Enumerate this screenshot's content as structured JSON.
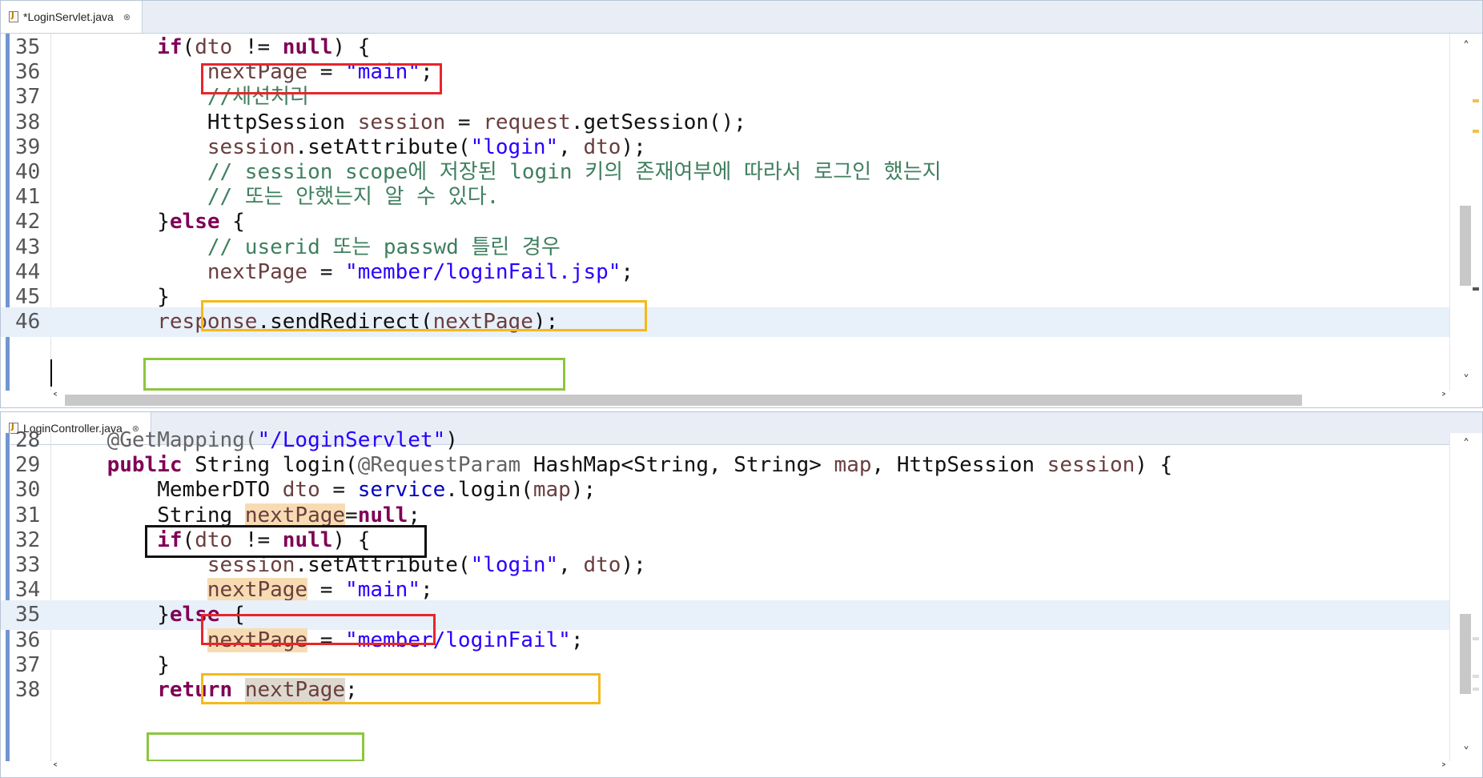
{
  "top_editor": {
    "tab_title": "*LoginServlet.java",
    "tab_close": "⊗",
    "lines": [
      {
        "num": "35",
        "tokens": [
          [
            "        ",
            ""
          ],
          [
            "if",
            "kw"
          ],
          [
            "(",
            ""
          ],
          [
            "dto",
            "var"
          ],
          [
            " != ",
            ""
          ],
          [
            "null",
            "kw"
          ],
          [
            ") {",
            ""
          ]
        ]
      },
      {
        "num": "36",
        "tokens": [
          [
            "            ",
            ""
          ],
          [
            "nextPage",
            "var"
          ],
          [
            " = ",
            ""
          ],
          [
            "\"main\"",
            "str"
          ],
          [
            ";",
            ""
          ]
        ]
      },
      {
        "num": "37",
        "tokens": [
          [
            "            ",
            ""
          ],
          [
            "//세션처리",
            "cm"
          ]
        ]
      },
      {
        "num": "38",
        "tokens": [
          [
            "            ",
            ""
          ],
          [
            "HttpSession ",
            ""
          ],
          [
            "session",
            "var"
          ],
          [
            " = ",
            ""
          ],
          [
            "request",
            "var"
          ],
          [
            ".getSession();",
            ""
          ]
        ]
      },
      {
        "num": "39",
        "tokens": [
          [
            "            ",
            ""
          ],
          [
            "session",
            "var"
          ],
          [
            ".setAttribute(",
            ""
          ],
          [
            "\"login\"",
            "str"
          ],
          [
            ", ",
            ""
          ],
          [
            "dto",
            "var"
          ],
          [
            ");",
            ""
          ]
        ]
      },
      {
        "num": "40",
        "tokens": [
          [
            "            ",
            ""
          ],
          [
            "// session scope에 저장된 login 키의 존재여부에 따라서 로그인 했는지",
            "cm"
          ]
        ]
      },
      {
        "num": "41",
        "tokens": [
          [
            "            ",
            ""
          ],
          [
            "// 또는 안했는지 알 수 있다.",
            "cm"
          ]
        ]
      },
      {
        "num": "42",
        "tokens": [
          [
            "        ",
            ""
          ],
          [
            "}",
            ""
          ],
          [
            "else",
            "kw"
          ],
          [
            " {",
            ""
          ]
        ]
      },
      {
        "num": "43",
        "tokens": [
          [
            "            ",
            ""
          ],
          [
            "// userid 또는 passwd 틀린 경우",
            "cm"
          ]
        ]
      },
      {
        "num": "44",
        "tokens": [
          [
            "            ",
            ""
          ],
          [
            "nextPage",
            "var"
          ],
          [
            " = ",
            ""
          ],
          [
            "\"member/loginFail.jsp\"",
            "str"
          ],
          [
            ";",
            ""
          ]
        ]
      },
      {
        "num": "45",
        "tokens": [
          [
            "        ",
            ""
          ],
          [
            "}",
            ""
          ]
        ]
      },
      {
        "num": "46",
        "tokens": [
          [
            "        ",
            ""
          ],
          [
            "response",
            "var"
          ],
          [
            ".sendRedirect(",
            ""
          ],
          [
            "nextPage",
            "var"
          ],
          [
            ");",
            ""
          ]
        ]
      }
    ]
  },
  "bottom_editor": {
    "tab_title": "LoginController.java",
    "tab_close": "⊗",
    "lines": [
      {
        "num": "28",
        "tokens": [
          [
            "    ",
            ""
          ],
          [
            "@GetMapping(",
            "ann"
          ],
          [
            "\"/LoginServlet\"",
            "str"
          ],
          [
            ")",
            ""
          ]
        ]
      },
      {
        "num": "29",
        "tokens": [
          [
            "    ",
            ""
          ],
          [
            "public",
            "kw"
          ],
          [
            " String login(",
            ""
          ],
          [
            "@RequestParam",
            "ann"
          ],
          [
            " HashMap<String, String> ",
            ""
          ],
          [
            "map",
            "var"
          ],
          [
            ", HttpSession ",
            ""
          ],
          [
            "session",
            "var"
          ],
          [
            ") {",
            ""
          ]
        ]
      },
      {
        "num": "30",
        "tokens": [
          [
            "        ",
            ""
          ],
          [
            "MemberDTO ",
            ""
          ],
          [
            "dto",
            "var"
          ],
          [
            " = ",
            ""
          ],
          [
            "service",
            "fld"
          ],
          [
            ".login(",
            ""
          ],
          [
            "map",
            "var"
          ],
          [
            ");",
            ""
          ]
        ]
      },
      {
        "num": "31",
        "tokens": [
          [
            "        ",
            ""
          ],
          [
            "String ",
            ""
          ],
          [
            "nextPage",
            "var occ"
          ],
          [
            "=",
            ""
          ],
          [
            "null",
            "kw"
          ],
          [
            ";",
            ""
          ]
        ]
      },
      {
        "num": "32",
        "tokens": [
          [
            "        ",
            ""
          ],
          [
            "if",
            "kw"
          ],
          [
            "(",
            ""
          ],
          [
            "dto",
            "var"
          ],
          [
            " != ",
            ""
          ],
          [
            "null",
            "kw"
          ],
          [
            ") {",
            ""
          ]
        ]
      },
      {
        "num": "33",
        "tokens": [
          [
            "            ",
            ""
          ],
          [
            "session",
            "var"
          ],
          [
            ".setAttribute(",
            ""
          ],
          [
            "\"login\"",
            "str"
          ],
          [
            ", ",
            ""
          ],
          [
            "dto",
            "var"
          ],
          [
            ");",
            ""
          ]
        ]
      },
      {
        "num": "34",
        "tokens": [
          [
            "            ",
            ""
          ],
          [
            "nextPage",
            "var occ"
          ],
          [
            " = ",
            ""
          ],
          [
            "\"main\"",
            "str"
          ],
          [
            ";",
            ""
          ]
        ]
      },
      {
        "num": "35",
        "tokens": [
          [
            "        ",
            ""
          ],
          [
            "}",
            ""
          ],
          [
            "else",
            "kw"
          ],
          [
            " {",
            ""
          ]
        ]
      },
      {
        "num": "36",
        "tokens": [
          [
            "            ",
            ""
          ],
          [
            "nextPage",
            "var occ"
          ],
          [
            " = ",
            ""
          ],
          [
            "\"member/loginFail\"",
            "str"
          ],
          [
            ";",
            ""
          ]
        ]
      },
      {
        "num": "37",
        "tokens": [
          [
            "        ",
            ""
          ],
          [
            "}",
            ""
          ]
        ]
      },
      {
        "num": "38",
        "tokens": [
          [
            "        ",
            ""
          ],
          [
            "return",
            "kw"
          ],
          [
            " ",
            ""
          ],
          [
            "nextPage",
            "var occ2"
          ],
          [
            ";",
            ""
          ]
        ]
      }
    ]
  },
  "scroll": {
    "up": "˄",
    "down": "˅",
    "left": "˂",
    "right": "˃"
  }
}
